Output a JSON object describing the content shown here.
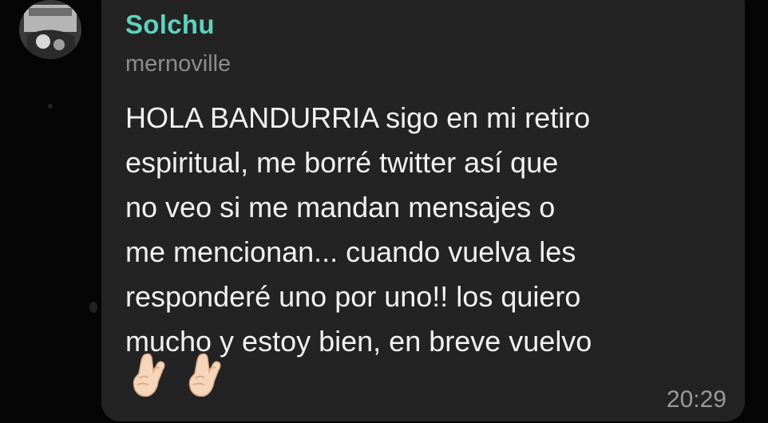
{
  "message": {
    "sender_name": "Solchu",
    "username": "mernoville",
    "text": "HOLA BANDURRIA sigo en mi retiro\nespiritual, me borré twitter así que\nno veo si me mandan mensajes o\nme mencionan... cuando vuelva les\nresponderé uno por uno!! los quiero\nmucho y estoy bien, en breve vuelvo",
    "emojis": [
      "crossed-fingers-icon",
      "crossed-fingers-icon"
    ],
    "time": "20:29"
  },
  "colors": {
    "sender_name": "#5fd2be",
    "bubble": "#232323",
    "background": "#050505",
    "text": "#f2f2f2",
    "meta": "#8d8d8d"
  }
}
